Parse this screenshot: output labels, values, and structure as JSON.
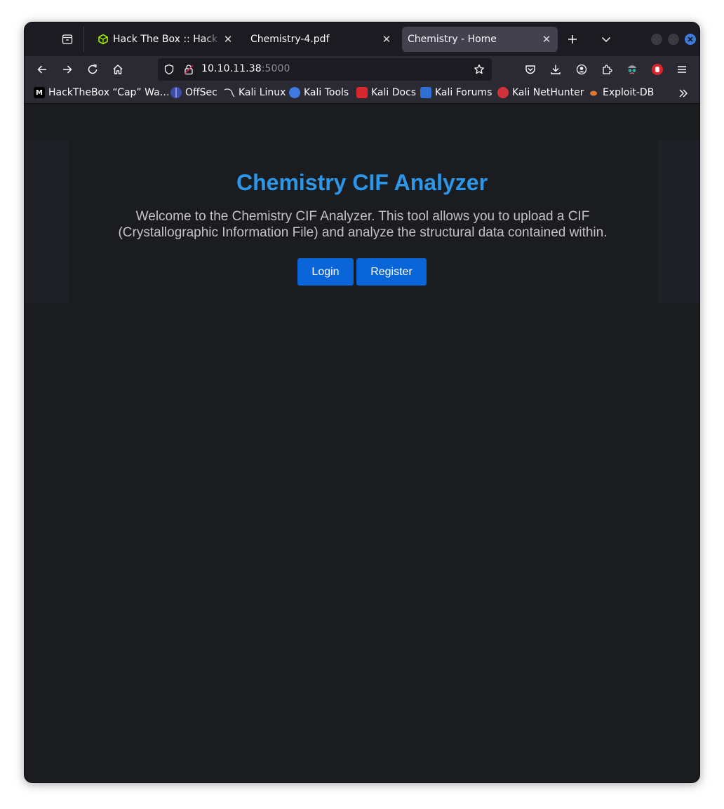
{
  "browser": {
    "tabs": [
      {
        "title": "Hack The Box :: Hack The Box",
        "favicon": "htb-cube-icon",
        "active": false
      },
      {
        "title": "Chemistry-4.pdf",
        "favicon": "pdf-icon",
        "active": false
      },
      {
        "title": "Chemistry - Home",
        "favicon": "",
        "active": true
      }
    ],
    "url": {
      "host": "10.10.11.38",
      "port": ":5000"
    },
    "bookmarks": [
      {
        "label": "HackTheBox “Cap” Wa…",
        "icon": "medium-icon"
      },
      {
        "label": "OffSec",
        "icon": "offsec-icon"
      },
      {
        "label": "Kali Linux",
        "icon": "kali-dragon-icon"
      },
      {
        "label": "Kali Tools",
        "icon": "kali-tools-icon"
      },
      {
        "label": "Kali Docs",
        "icon": "kali-docs-icon"
      },
      {
        "label": "Kali Forums",
        "icon": "kali-forums-icon"
      },
      {
        "label": "Kali NetHunter",
        "icon": "nethunter-icon"
      },
      {
        "label": "Exploit-DB",
        "icon": "exploitdb-icon"
      }
    ],
    "colors": {
      "accent": "#3d7bd9",
      "active_tab": "#42414d",
      "toolbar": "#2b2a33"
    }
  },
  "page": {
    "heading": "Chemistry CIF Analyzer",
    "description": "Welcome to the Chemistry CIF Analyzer. This tool allows you to upload a CIF (Crystallographic Information File) and analyze the structural data contained within.",
    "login_label": "Login",
    "register_label": "Register",
    "colors": {
      "heading": "#2c97e8",
      "button": "#0a66d8",
      "background": "#1b1c20"
    }
  }
}
